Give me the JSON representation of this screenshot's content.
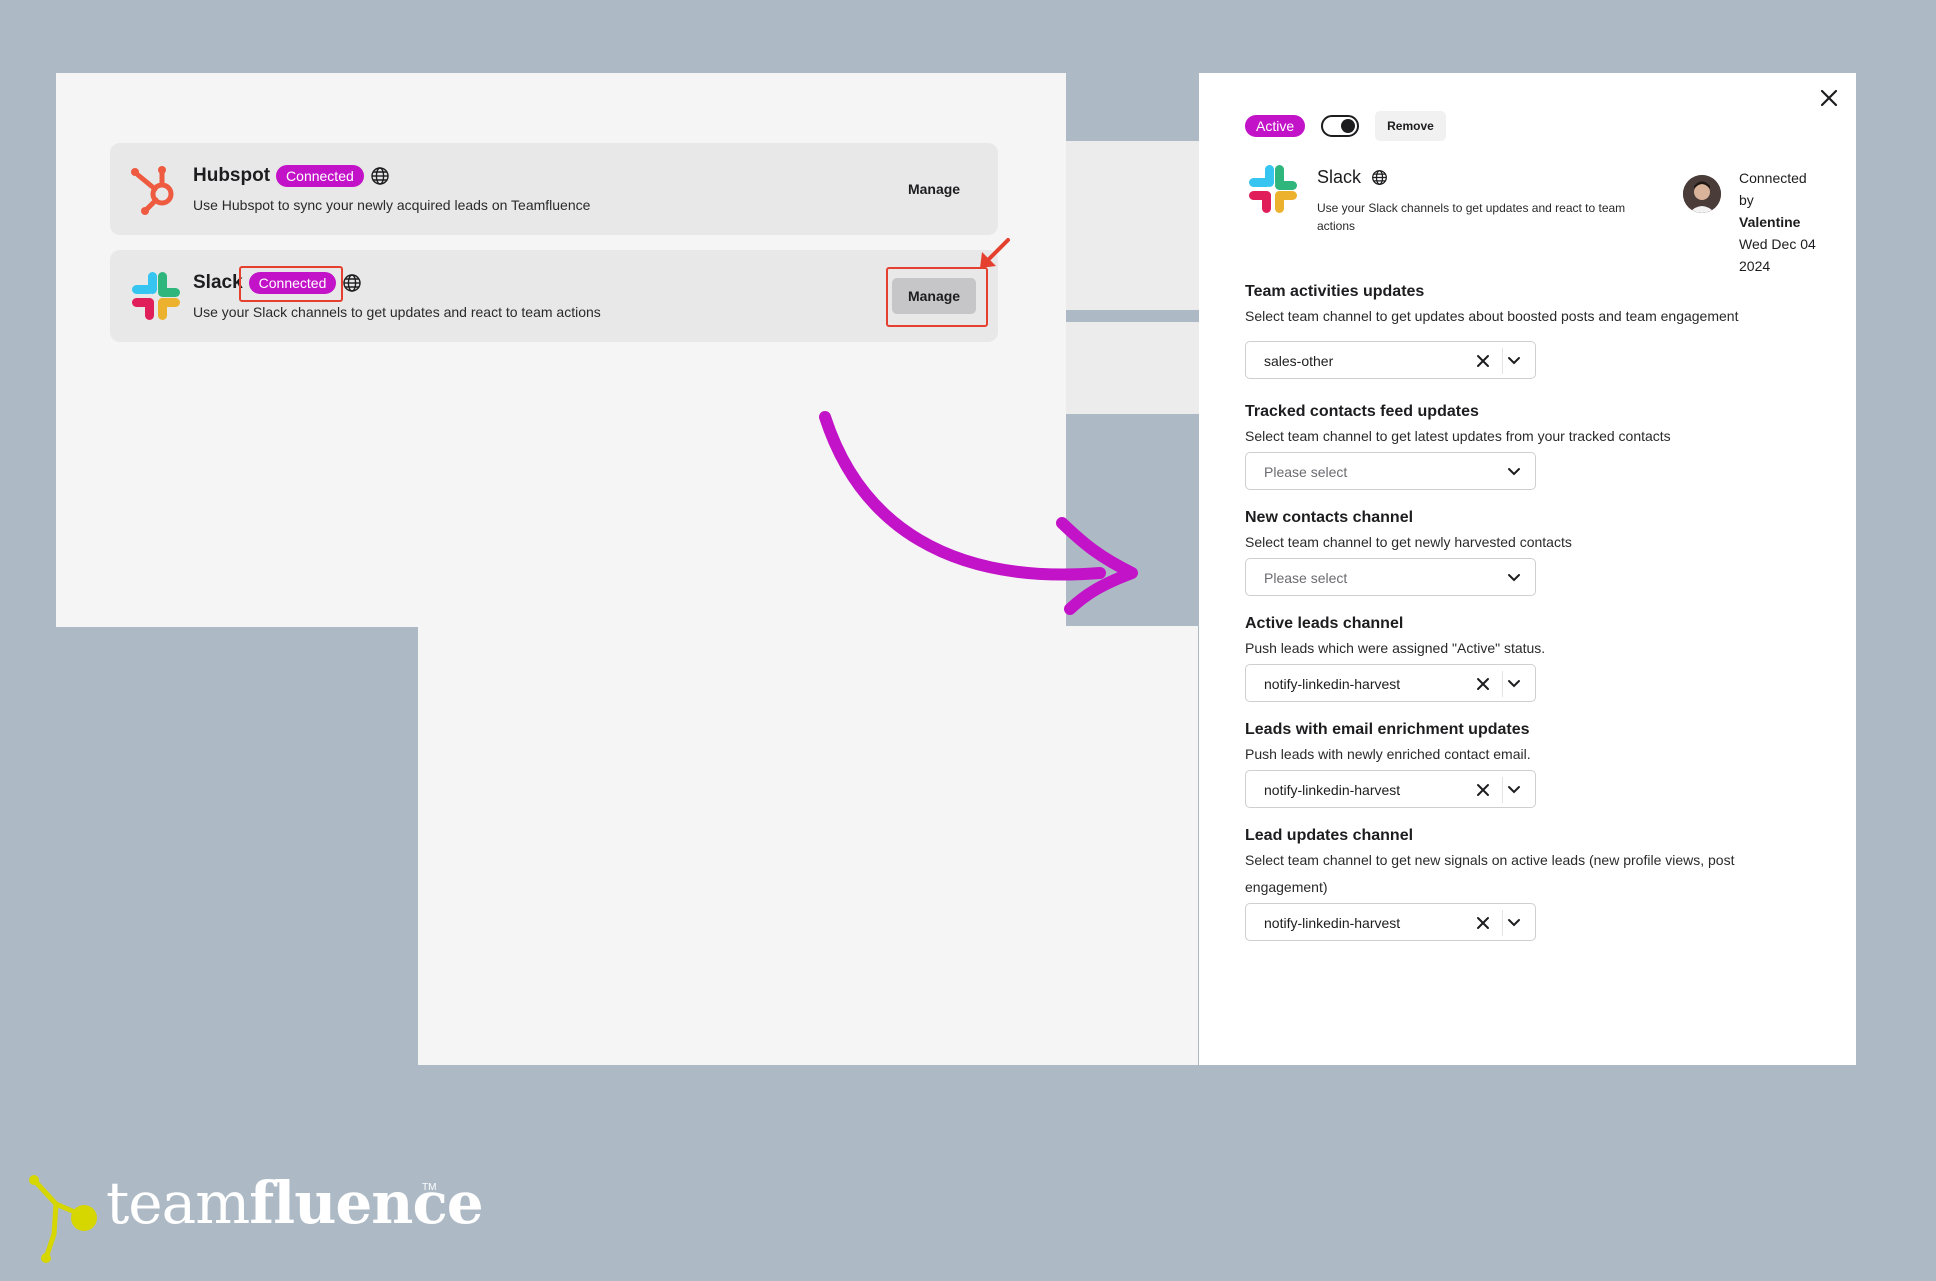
{
  "integrations": [
    {
      "name": "Hubspot",
      "status": "Connected",
      "description": "Use Hubspot to sync your newly acquired leads on Teamfluence",
      "action": "Manage"
    },
    {
      "name": "Slack",
      "status": "Connected",
      "description": "Use your Slack channels to get updates and react to team actions",
      "action": "Manage"
    }
  ],
  "drawer": {
    "status": "Active",
    "toggle_on": true,
    "remove_label": "Remove",
    "name": "Slack",
    "description": "Use your Slack channels to get updates and react to team actions",
    "connected_by_label": "Connected by",
    "connected_by": "Valentine",
    "connected_date": "Wed Dec 04 2024",
    "sections": [
      {
        "title": "Team activities updates",
        "desc": "Select team channel to get updates about boosted posts and team engagement",
        "value": "sales-other"
      },
      {
        "title": "Tracked contacts feed updates",
        "desc": "Select team channel to get latest updates from your tracked contacts",
        "placeholder": "Please select"
      },
      {
        "title": "New contacts channel",
        "desc": "Select team channel to get newly harvested contacts",
        "placeholder": "Please select"
      },
      {
        "title": "Active leads channel",
        "desc": "Push leads which were assigned \"Active\" status.",
        "value": "notify-linkedin-harvest"
      },
      {
        "title": "Leads with email enrichment updates",
        "desc": "Push leads with newly enriched contact email.",
        "value": "notify-linkedin-harvest"
      },
      {
        "title": "Lead updates channel",
        "desc": "Select team channel to get new signals on active leads (new profile views, post engagement)",
        "value": "notify-linkedin-harvest"
      }
    ]
  },
  "brand": {
    "light": "team",
    "bold": "fluence",
    "tm": "TM"
  },
  "colors": {
    "accent": "#c313c8",
    "highlight": "#e5402f",
    "background": "#adbac6"
  }
}
